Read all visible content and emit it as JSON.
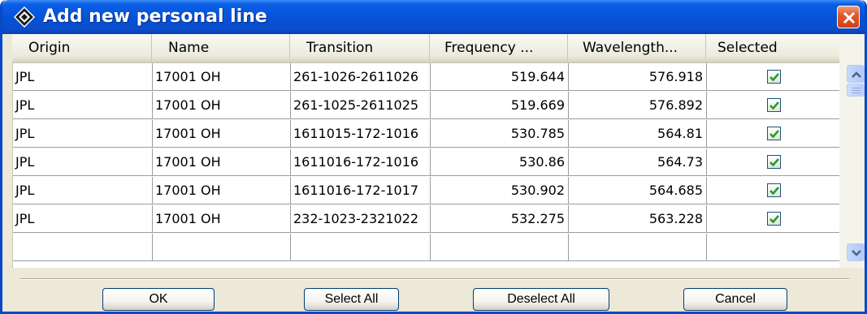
{
  "window": {
    "title": "Add new personal line"
  },
  "table": {
    "columns": [
      "Origin",
      "Name",
      "Transition",
      "Frequency ...",
      "Wavelength...",
      "Selected"
    ],
    "rows": [
      {
        "origin": "JPL",
        "name": "17001  OH",
        "transition": "261-1026-2611026",
        "frequency": "519.644",
        "wavelength": "576.918",
        "selected": true
      },
      {
        "origin": "JPL",
        "name": "17001  OH",
        "transition": "261-1025-2611025",
        "frequency": "519.669",
        "wavelength": "576.892",
        "selected": true
      },
      {
        "origin": "JPL",
        "name": "17001  OH",
        "transition": "1611015-172-1016",
        "frequency": "530.785",
        "wavelength": "564.81",
        "selected": true
      },
      {
        "origin": "JPL",
        "name": "17001  OH",
        "transition": "1611016-172-1016",
        "frequency": "530.86",
        "wavelength": "564.73",
        "selected": true
      },
      {
        "origin": "JPL",
        "name": "17001  OH",
        "transition": "1611016-172-1017",
        "frequency": "530.902",
        "wavelength": "564.685",
        "selected": true
      },
      {
        "origin": "JPL",
        "name": "17001  OH",
        "transition": "232-1023-2321022",
        "frequency": "532.275",
        "wavelength": "563.228",
        "selected": true
      }
    ]
  },
  "buttons": {
    "ok": "OK",
    "select_all": "Select All",
    "deselect_all": "Deselect All",
    "cancel": "Cancel"
  },
  "icons": {
    "app": "app-diamond-icon",
    "close": "close-icon",
    "scroll_up": "chevron-up-icon",
    "scroll_down": "chevron-down-icon",
    "check": "check-icon"
  },
  "colors": {
    "titlebar": "#0553d8",
    "close": "#e05a2a",
    "check": "#21a121"
  }
}
